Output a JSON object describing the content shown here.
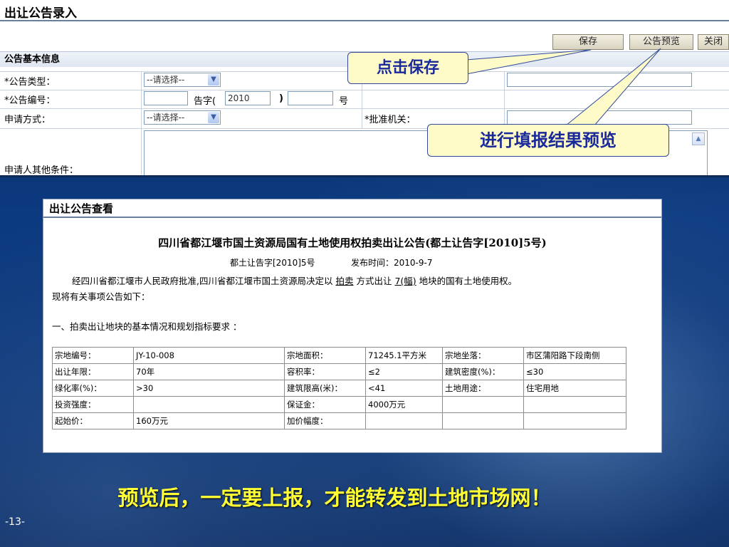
{
  "top_form": {
    "title": "出让公告录入",
    "buttons": {
      "save": "保存",
      "preview": "公告预览",
      "close": "关闭"
    },
    "section_title": "公告基本信息",
    "fields": {
      "type_label": "*公告类型：",
      "type_value": "--请选择--",
      "number_label": "*公告编号：",
      "number_prefix": "告字(",
      "number_year": "2010",
      "number_close": ")",
      "number_suffix": "号",
      "apply_label": "申请方式：",
      "apply_value": "--请选择--",
      "approval_label": "*批准机关：",
      "other_label": "申请人其他条件："
    }
  },
  "callouts": {
    "save": "点击保存",
    "preview": "进行填报结果预览"
  },
  "preview": {
    "panel_title": "出让公告查看",
    "heading": "四川省都江堰市国土资源局国有土地使用权拍卖出让公告(都土让告字[2010]5号)",
    "doc_no": "都土让告字[2010]5号",
    "publish_label": "发布时间：",
    "publish_date": "2010-9-7",
    "para1_a": "经四川省都江堰市人民政府批准,四川省都江堰市国土资源局决定以",
    "para1_method": "拍卖",
    "para1_b": "方式出让",
    "para1_count": "7(幅)",
    "para1_c": "地块的国有土地使用权。",
    "para2": "现将有关事项公告如下：",
    "section1": "一、拍卖出让地块的基本情况和规划指标要求 ：",
    "table": [
      [
        "宗地编号：",
        "JY-10-008",
        "宗地面积：",
        "71245.1平方米",
        "宗地坐落：",
        "市区蒲阳路下段南侧"
      ],
      [
        "出让年限：",
        "70年",
        "容积率：",
        "≤2",
        "建筑密度(%)：",
        "≤30"
      ],
      [
        "绿化率(%)：",
        ">30",
        "建筑限高(米)：",
        "<41",
        "土地用途：",
        "住宅用地"
      ],
      [
        "投资强度：",
        "",
        "保证金：",
        "4000万元",
        "",
        ""
      ],
      [
        "起始价：",
        "160万元",
        "加价幅度：",
        "",
        "",
        ""
      ]
    ]
  },
  "footer": {
    "message": "预览后，一定要上报，才能转发到土地市场网！",
    "page_number": "-13-"
  }
}
